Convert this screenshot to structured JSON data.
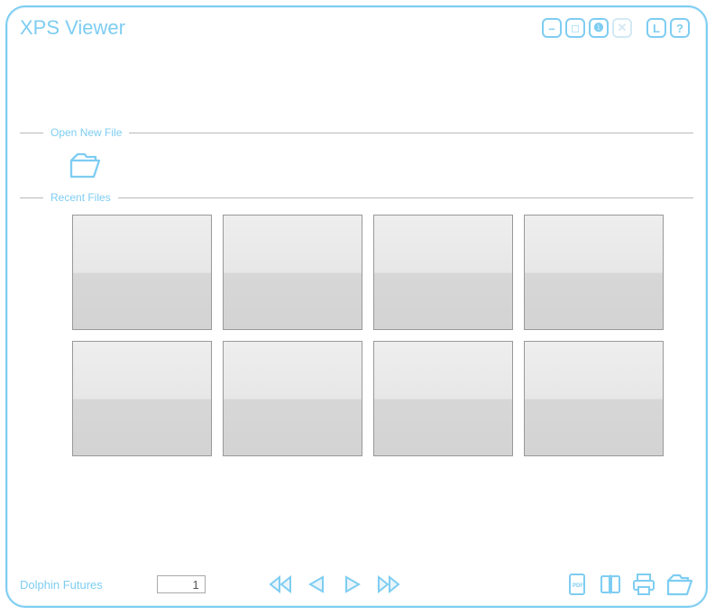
{
  "window": {
    "title": "XPS Viewer"
  },
  "sections": {
    "open_label": "Open New File",
    "recent_label": "Recent Files"
  },
  "titlebar_icons": {
    "minimize_glyph": "–",
    "maximize_glyph": "□",
    "info_glyph": "❶",
    "close_glyph": "✕",
    "lang_glyph": "L",
    "help_glyph": "?"
  },
  "footer": {
    "brand": "Dolphin Futures",
    "page_value": "1"
  },
  "recent_thumbs": [
    {
      "id": 1
    },
    {
      "id": 2
    },
    {
      "id": 3
    },
    {
      "id": 4
    },
    {
      "id": 5
    },
    {
      "id": 6
    },
    {
      "id": 7
    },
    {
      "id": 8
    }
  ]
}
